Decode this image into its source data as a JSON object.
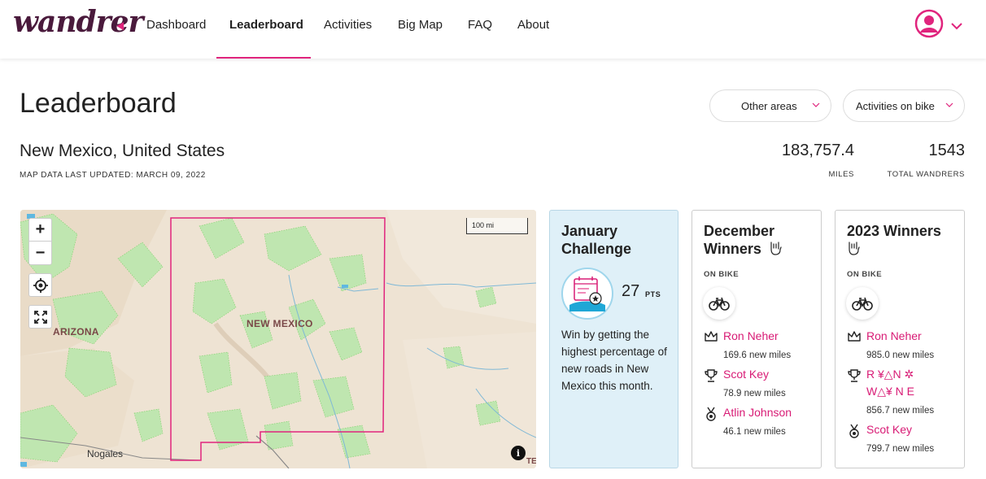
{
  "brand": {
    "logo_text": "wandrer",
    "accent": "#e0247d",
    "logo_color": "#4a1a3c"
  },
  "nav": {
    "items": [
      {
        "label": "Dashboard",
        "active": false
      },
      {
        "label": "Leaderboard",
        "active": true
      },
      {
        "label": "Activities",
        "active": false
      },
      {
        "label": "Big Map",
        "active": false
      },
      {
        "label": "FAQ",
        "active": false
      },
      {
        "label": "About",
        "active": false
      }
    ],
    "account_icon": "user-circle-icon",
    "account_menu_icon": "chevron-down-icon"
  },
  "header": {
    "title": "Leaderboard",
    "area_select": "Other areas",
    "activity_select": "Activities on bike"
  },
  "region": {
    "name": "New Mexico, United States",
    "updated": "MAP DATA LAST UPDATED: MARCH 09, 2022"
  },
  "stats": {
    "miles": {
      "value": "183,757.4",
      "label": "MILES"
    },
    "wandrers": {
      "value": "1543",
      "label": "TOTAL WANDRERS"
    }
  },
  "map": {
    "zoom_in": "+",
    "zoom_out": "−",
    "scale": "100 mi",
    "labels": {
      "state": "NEW MEXICO",
      "neighbor": "ARIZONA",
      "city": "Nogales",
      "edge": "TE"
    },
    "info": "i",
    "boundary_color": "#e0247d"
  },
  "challenge": {
    "title": "January Challenge",
    "points": "27",
    "points_label": "PTS",
    "description": "Win by getting the highest percentage of new roads in New Mexico this month."
  },
  "december": {
    "title": "December Winners",
    "sub": "ON BIKE",
    "winners": [
      {
        "name": "Ron Neher",
        "miles": "169.6 new miles",
        "icon": "crown-icon"
      },
      {
        "name": "Scot Key",
        "miles": "78.9 new miles",
        "icon": "trophy-icon"
      },
      {
        "name": "Atlin Johnson",
        "miles": "46.1 new miles",
        "icon": "medal-icon"
      }
    ]
  },
  "year2023": {
    "title": "2023 Winners",
    "sub": "ON BIKE",
    "winners": [
      {
        "name": "Ron Neher",
        "miles": "985.0 new miles",
        "icon": "crown-icon"
      },
      {
        "name_line1": "R ¥△N ✲",
        "name_line2": "W△¥ N E",
        "miles": "856.7 new miles",
        "icon": "trophy-icon"
      },
      {
        "name": "Scot Key",
        "miles": "799.7 new miles",
        "icon": "medal-icon"
      }
    ]
  }
}
